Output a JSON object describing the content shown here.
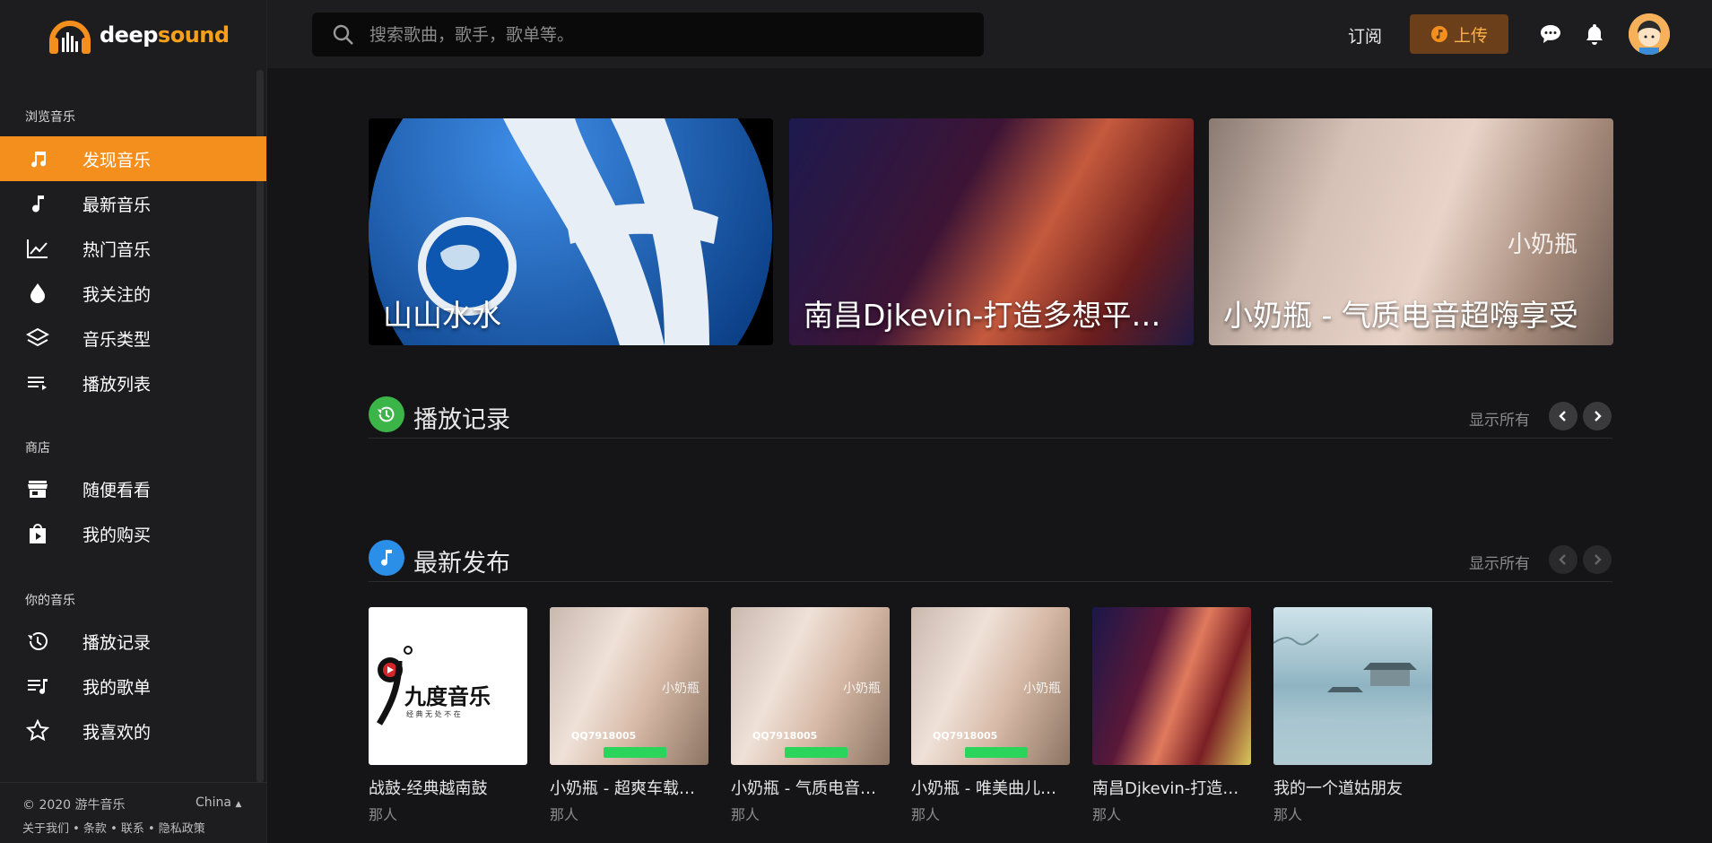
{
  "app": {
    "logo_text_part1": "deep",
    "logo_text_part2": "sound"
  },
  "sidebar": {
    "sections": [
      {
        "title": "浏览音乐",
        "items": [
          {
            "label": "发现音乐",
            "icon": "music-note-icon",
            "active": true
          },
          {
            "label": "最新音乐",
            "icon": "single-note-icon"
          },
          {
            "label": "热门音乐",
            "icon": "trending-chart-icon"
          },
          {
            "label": "我关注的",
            "icon": "drop-icon"
          },
          {
            "label": "音乐类型",
            "icon": "layers-icon"
          },
          {
            "label": "播放列表",
            "icon": "playlist-icon"
          }
        ]
      },
      {
        "title": "商店",
        "items": [
          {
            "label": "随便看看",
            "icon": "store-icon"
          },
          {
            "label": "我的购买",
            "icon": "shopping-bag-icon"
          }
        ]
      },
      {
        "title": "你的音乐",
        "items": [
          {
            "label": "播放记录",
            "icon": "history-icon"
          },
          {
            "label": "我的歌单",
            "icon": "my-playlist-icon"
          },
          {
            "label": "我喜欢的",
            "icon": "star-icon"
          }
        ]
      }
    ],
    "footer": {
      "copyright": "© 2020 游牛音乐",
      "language": "China",
      "links": "关于我们 • 条款 • 联系 • 隐私政策"
    }
  },
  "header": {
    "search_placeholder": "搜索歌曲，歌手，歌单等。",
    "subscribe_label": "订阅",
    "upload_label": "上传"
  },
  "banners": [
    {
      "title": "山山水水"
    },
    {
      "title": "南昌Djkevin-打造多想平庸的我"
    },
    {
      "title": "小奶瓶 - 气质电音超嗨享受"
    }
  ],
  "sections": {
    "history": {
      "title": "播放记录",
      "show_all": "显示所有"
    },
    "latest": {
      "title": "最新发布",
      "show_all": "显示所有"
    }
  },
  "latest_tracks": [
    {
      "title": "战鼓-经典越南鼓",
      "artist": "那人",
      "cover": "jiudu"
    },
    {
      "title": "小奶瓶 - 超爽车载音乐",
      "artist": "那人",
      "cover": "girl"
    },
    {
      "title": "小奶瓶 - 气质电音超嗨享受",
      "artist": "那人",
      "cover": "girl"
    },
    {
      "title": "小奶瓶 - 唯美曲儿合集",
      "artist": "那人",
      "cover": "girl"
    },
    {
      "title": "南昌Djkevin-打造多想平庸的我",
      "artist": "那人",
      "cover": "dj"
    },
    {
      "title": "我的一个道姑朋友",
      "artist": "那人",
      "cover": "paint"
    }
  ],
  "cover_texts": {
    "jiudu_brand": "九度音乐",
    "jiudu_slogan": "经 典 无 处 不 在",
    "girl_qq": "QQ7918005",
    "girl_mark": "小奶瓶",
    "banner_mark": "小奶瓶"
  },
  "colors": {
    "accent": "#f48f1e",
    "history_icon_bg": "#3cb548",
    "latest_icon_bg": "#2b8fe8"
  }
}
